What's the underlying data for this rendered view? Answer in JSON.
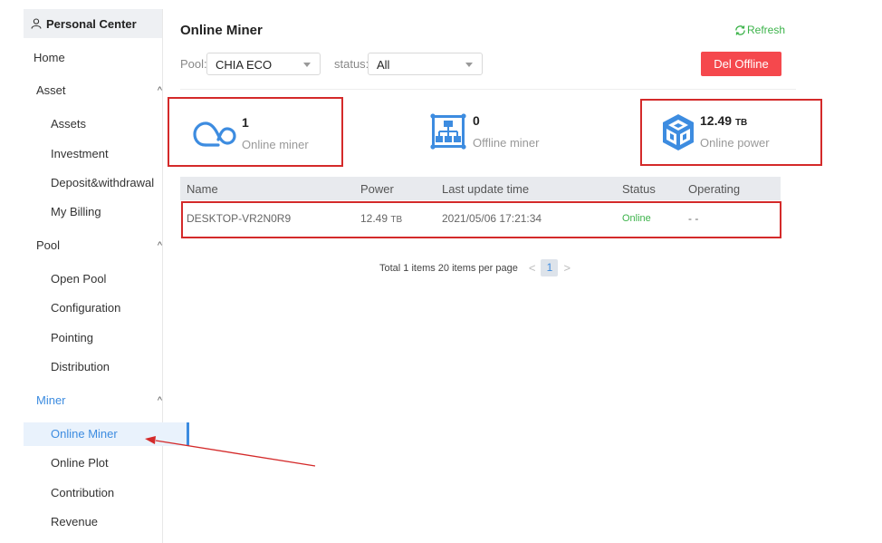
{
  "sidebar": {
    "header": "Personal Center",
    "home": "Home",
    "asset": {
      "label": "Asset",
      "items": [
        "Assets",
        "Investment",
        "Deposit&withdrawal",
        "My Billing"
      ]
    },
    "pool": {
      "label": "Pool",
      "items": [
        "Open Pool",
        "Configuration",
        "Pointing",
        "Distribution"
      ]
    },
    "miner": {
      "label": "Miner",
      "items": [
        "Online Miner",
        "Online Plot",
        "Contribution",
        "Revenue"
      ]
    },
    "chevron": "^"
  },
  "page": {
    "title": "Online Miner",
    "refresh": "Refresh",
    "pool_label": "Pool:",
    "pool_value": "CHIA ECO",
    "status_label": "status:",
    "status_value": "All",
    "del_offline": "Del Offline"
  },
  "stats": {
    "online": {
      "value": "1",
      "label": "Online miner",
      "icon": "cloud-icon"
    },
    "offline": {
      "value": "0",
      "label": "Offline miner",
      "icon": "network-icon"
    },
    "power": {
      "value": "12.49",
      "unit": "TB",
      "label": "Online power",
      "icon": "cube-icon"
    }
  },
  "table": {
    "headers": [
      "Name",
      "Power",
      "Last update time",
      "Status",
      "Operating"
    ],
    "rows": [
      {
        "name": "DESKTOP-VR2N0R9",
        "power": "12.49",
        "unit": "TB",
        "time": "2021/05/06 17:21:34",
        "status": "Online",
        "operating": "- -"
      }
    ]
  },
  "pagination": {
    "summary": "Total 1 items 20 items per page",
    "current": "1",
    "prev": "<",
    "next": ">"
  },
  "colors": {
    "accent": "#3d8ce0",
    "danger": "#f5484d",
    "success": "#3cb34a",
    "annotation": "#d42a2a"
  }
}
